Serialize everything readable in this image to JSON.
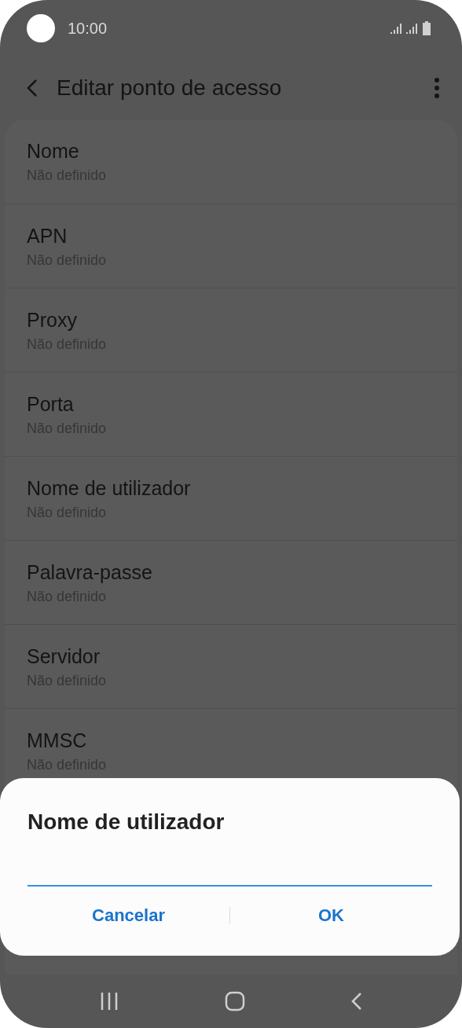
{
  "status_bar": {
    "time": "10:00"
  },
  "app_bar": {
    "title": "Editar ponto de acesso"
  },
  "settings": [
    {
      "title": "Nome",
      "value": "Não definido"
    },
    {
      "title": "APN",
      "value": "Não definido"
    },
    {
      "title": "Proxy",
      "value": "Não definido"
    },
    {
      "title": "Porta",
      "value": "Não definido"
    },
    {
      "title": "Nome de utilizador",
      "value": "Não definido"
    },
    {
      "title": "Palavra-passe",
      "value": "Não definido"
    },
    {
      "title": "Servidor",
      "value": "Não definido"
    },
    {
      "title": "MMSC",
      "value": "Não definido"
    }
  ],
  "dialog": {
    "title": "Nome de utilizador",
    "buttons": [
      "Cancelar",
      "OK"
    ]
  }
}
